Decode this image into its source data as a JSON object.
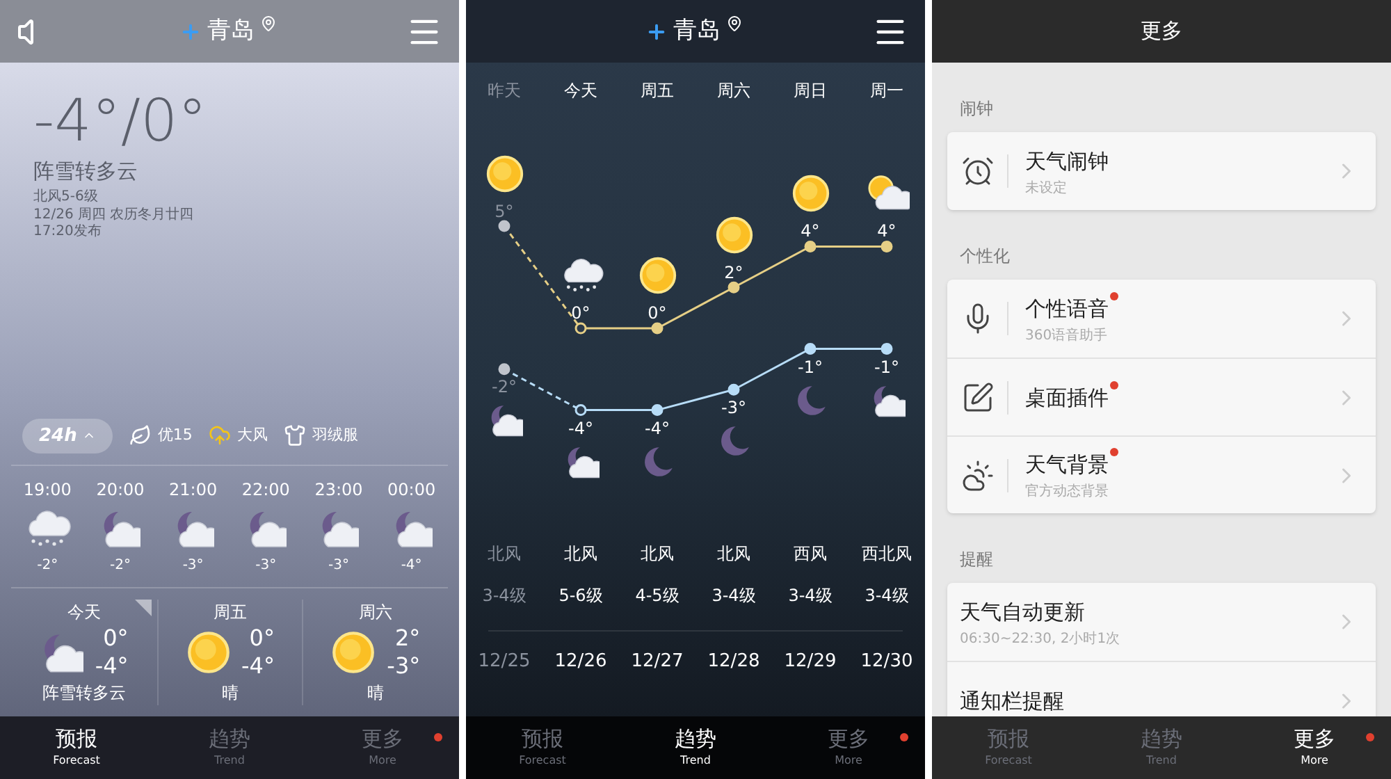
{
  "forecast_screen": {
    "header": {
      "city": "青岛"
    },
    "current": {
      "temperature": "-4°/0°",
      "condition": "阵雪转多云",
      "wind": "北风5-6级",
      "date": "12/26 周四 农历冬月廿四",
      "published": "17:20发布"
    },
    "toolbar": {
      "range_button": "24h",
      "air_quality": "优15",
      "warning": "大风",
      "clothing": "羽绒服"
    },
    "hourly": [
      {
        "time": "19:00",
        "kind": "snow",
        "temp": "-2°"
      },
      {
        "time": "20:00",
        "kind": "moon-cloud",
        "temp": "-2°"
      },
      {
        "time": "21:00",
        "kind": "moon-cloud",
        "temp": "-3°"
      },
      {
        "time": "22:00",
        "kind": "moon-cloud",
        "temp": "-3°"
      },
      {
        "time": "23:00",
        "kind": "moon-cloud",
        "temp": "-3°"
      },
      {
        "time": "00:00",
        "kind": "moon-cloud",
        "temp": "-4°"
      }
    ],
    "daily": [
      {
        "day": "今天",
        "kind": "moon-cloud",
        "high": "0°",
        "low": "-4°",
        "condition": "阵雪转多云",
        "selected": true
      },
      {
        "day": "周五",
        "kind": "sun",
        "high": "0°",
        "low": "-4°",
        "condition": "晴",
        "selected": false
      },
      {
        "day": "周六",
        "kind": "sun",
        "high": "2°",
        "low": "-3°",
        "condition": "晴",
        "selected": false
      }
    ],
    "nav": [
      {
        "label": "预报",
        "sublabel": "Forecast",
        "selected": true,
        "new": false
      },
      {
        "label": "趋势",
        "sublabel": "Trend",
        "selected": false,
        "new": false
      },
      {
        "label": "更多",
        "sublabel": "More",
        "selected": false,
        "new": true
      }
    ]
  },
  "trend_screen": {
    "header": {
      "city": "青岛"
    },
    "chart_data": {
      "type": "line",
      "categories": [
        "昨天",
        "今天",
        "周五",
        "周六",
        "周日",
        "周一"
      ],
      "series": [
        {
          "color": "#e6cf86",
          "line_style": "dashed",
          "marker": "circle",
          "values": [
            5,
            0,
            0,
            2,
            4,
            4
          ],
          "value_labels": [
            "5°",
            "0°",
            "0°",
            "2°",
            "4°",
            "4°"
          ]
        },
        {
          "color": "#b7dcf7",
          "line_style": "dashed",
          "marker": "circle",
          "values": [
            -2,
            -4,
            -4,
            -3,
            -1,
            -1
          ],
          "value_labels": [
            "-2°",
            "-4°",
            "-4°",
            "-3°",
            "-1°",
            "-1°"
          ]
        }
      ]
    },
    "days": [
      {
        "past": true,
        "day_weather": {
          "kind": "sun"
        },
        "night_weather": {
          "kind": "moon-cloud"
        },
        "wind": "北风",
        "level": "3-4级",
        "date": "12/25"
      },
      {
        "past": false,
        "day_weather": {
          "kind": "snow"
        },
        "night_weather": {
          "kind": "moon-cloud"
        },
        "wind": "北风",
        "level": "5-6级",
        "date": "12/26"
      },
      {
        "past": false,
        "day_weather": {
          "kind": "sun"
        },
        "night_weather": {
          "kind": "moon"
        },
        "wind": "北风",
        "level": "4-5级",
        "date": "12/27"
      },
      {
        "past": false,
        "day_weather": {
          "kind": "sun"
        },
        "night_weather": {
          "kind": "moon"
        },
        "wind": "北风",
        "level": "3-4级",
        "date": "12/28"
      },
      {
        "past": false,
        "day_weather": {
          "kind": "sun"
        },
        "night_weather": {
          "kind": "moon"
        },
        "wind": "西风",
        "level": "3-4级",
        "date": "12/29"
      },
      {
        "past": false,
        "day_weather": {
          "kind": "sun-cloud"
        },
        "night_weather": {
          "kind": "moon-cloud"
        },
        "wind": "西北风",
        "level": "3-4级",
        "date": "12/30"
      }
    ],
    "nav": [
      {
        "label": "预报",
        "sublabel": "Forecast",
        "selected": false,
        "new": false
      },
      {
        "label": "趋势",
        "sublabel": "Trend",
        "selected": true,
        "new": false
      },
      {
        "label": "更多",
        "sublabel": "More",
        "selected": false,
        "new": true
      }
    ]
  },
  "more_screen": {
    "title": "更多",
    "sections": [
      {
        "heading": "闹钟",
        "items": [
          {
            "kind": "alarm",
            "title": "天气闹钟",
            "subtitle": "未设定",
            "new": false
          }
        ]
      },
      {
        "heading": "个性化",
        "items": [
          {
            "kind": "voice",
            "title": "个性语音",
            "subtitle": "360语音助手",
            "new": true
          },
          {
            "kind": "widget",
            "title": "桌面插件",
            "new": true
          },
          {
            "kind": "background",
            "title": "天气背景",
            "subtitle": "官方动态背景",
            "new": true
          }
        ]
      },
      {
        "heading": "提醒",
        "items": [
          {
            "kind": "plain",
            "title": "天气自动更新",
            "subtitle": "06:30~22:30, 2小时1次",
            "new": false
          },
          {
            "kind": "plain",
            "title": "通知栏提醒",
            "new": false
          }
        ]
      }
    ],
    "nav": [
      {
        "label": "预报",
        "sublabel": "Forecast",
        "selected": false,
        "new": false
      },
      {
        "label": "趋势",
        "sublabel": "Trend",
        "selected": false,
        "new": false
      },
      {
        "label": "更多",
        "sublabel": "More",
        "selected": true,
        "new": true
      }
    ]
  }
}
